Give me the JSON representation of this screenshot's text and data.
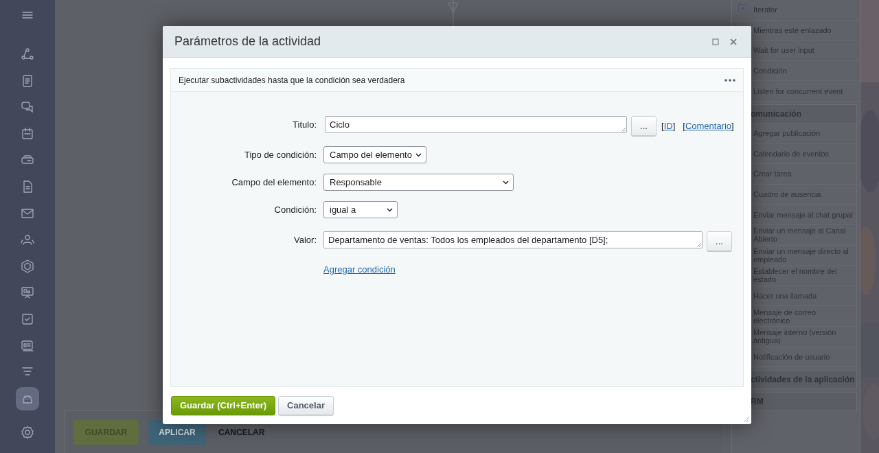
{
  "nav": [
    {
      "selected": false
    },
    {
      "selected": false
    },
    {
      "selected": false
    },
    {
      "selected": false
    },
    {
      "selected": false
    },
    {
      "selected": false
    },
    {
      "selected": false
    },
    {
      "selected": false
    },
    {
      "selected": false
    },
    {
      "selected": false
    },
    {
      "selected": false
    },
    {
      "selected": false
    },
    {
      "selected": false
    },
    {
      "selected": true
    }
  ],
  "page_buttons": [
    {
      "kind": "save",
      "label": "GUARDAR"
    },
    {
      "kind": "apply",
      "label": "APLICAR"
    },
    {
      "kind": "cancel",
      "label": "CANCELAR"
    }
  ],
  "toolbox": {
    "items": [
      "Iterator",
      "Mientras esté enlazado",
      "Wait for user input",
      "Condición",
      "Listen for concurrent event"
    ],
    "sections": [
      {
        "title": "omunicación",
        "items": [
          "Agregar publicación",
          "Calendario de eventos",
          "Crear tarea",
          "Cuadro de ausencia",
          "Enviar mensaje al chat grupal",
          "Enviar un mensaje al Canal Abierto",
          "Enviar un mensaje directo al empleado",
          "Establecer el nombre del estado",
          "Hacer una llamada",
          "Mensaje de correo electrónico",
          "Mensaje interno (versión antigua)",
          "Notificación de usuario"
        ]
      },
      {
        "title": "ctividades de la aplicación"
      },
      {
        "title": "RM"
      }
    ]
  },
  "dialog": {
    "title": "Parámetros de la actividad",
    "subtitle": "Ejecutar subactividades hasta que la condición sea verdadera",
    "fields": [
      {
        "label": "Titulo:",
        "kind": "textarea",
        "value": "Ciclo",
        "more_button": "...",
        "links": [
          {
            "before": "[",
            "label": "ID",
            "after": "]"
          },
          {
            "before": "[",
            "label": "Comentario",
            "after": "]"
          }
        ]
      },
      {
        "label": "Tipo de condición:",
        "kind": "select",
        "value": "Campo del elemento"
      },
      {
        "label": "Campo del elemento:",
        "kind": "select",
        "value": "Responsable"
      },
      {
        "label": "Condición:",
        "kind": "select",
        "value": "igual a"
      },
      {
        "label": "Valor:",
        "kind": "textarea",
        "value": "Departamento de ventas: Todos los empleados del departamento [D5];",
        "more_button": "..."
      }
    ],
    "add_condition": "Agregar condición",
    "buttons": [
      {
        "kind": "primary",
        "label": "Guardar (Ctrl+Enter)"
      },
      {
        "kind": "secondary",
        "label": "Cancelar"
      }
    ]
  }
}
